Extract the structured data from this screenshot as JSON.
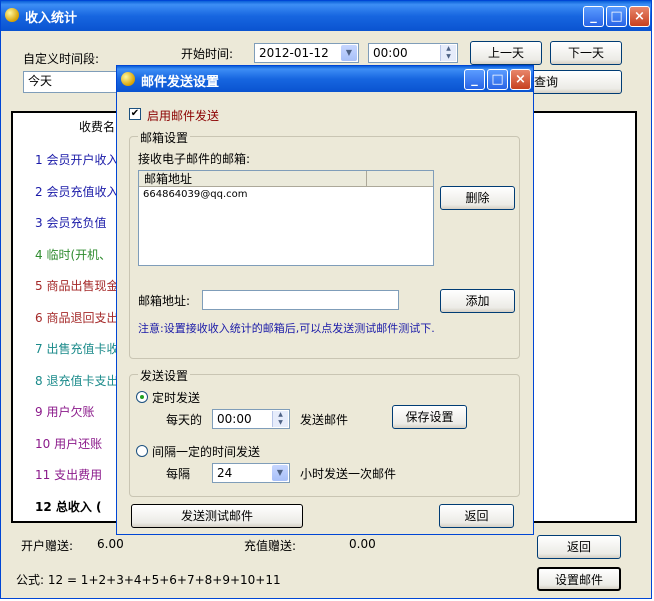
{
  "main": {
    "title": "收入统计",
    "custom_period_label": "自定义时间段:",
    "period_value": "今天",
    "start_time_label": "开始时间:",
    "start_date": "2012-01-12",
    "start_time": "00:00",
    "prev_day": "上一天",
    "next_day": "下一天",
    "query": "查询",
    "column_header": "收费名",
    "rows": [
      {
        "label": "1 会员开户收入",
        "color": "#1a1aa8"
      },
      {
        "label": "2 会员充值收入",
        "color": "#1a1aa8"
      },
      {
        "label": "3 会员充负值",
        "color": "#1a1aa8"
      },
      {
        "label": "4 临时(开机、",
        "color": "#2e8b2e"
      },
      {
        "label": "5 商品出售现金",
        "color": "#a52a2a"
      },
      {
        "label": "6 商品退回支出",
        "color": "#a52a2a"
      },
      {
        "label": "7 出售充值卡收",
        "color": "#1a8a8a"
      },
      {
        "label": "8 退充值卡支出",
        "color": "#1a8a8a"
      },
      {
        "label": "9 用户欠账",
        "color": "#8b1a8b"
      },
      {
        "label": "10 用户还账",
        "color": "#8b1a8b"
      },
      {
        "label": "11 支出费用",
        "color": "#8b1a8b"
      },
      {
        "label": "12 总收入 (",
        "color": "#000000"
      }
    ],
    "open_gift_label": "开户赠送:",
    "open_gift_value": "6.00",
    "recharge_gift_label": "充值赠送:",
    "recharge_gift_value": "0.00",
    "formula": "公式: 12 = 1+2+3+4+5+6+7+8+9+10+11",
    "back": "返回",
    "set_mail": "设置邮件"
  },
  "dialog": {
    "title": "邮件发送设置",
    "enable_label": "启用邮件发送",
    "enable_checked": true,
    "mailbox_group": "邮箱设置",
    "receive_label": "接收电子邮件的邮箱:",
    "list_header": "邮箱地址",
    "emails": [
      "664864039@qq.com"
    ],
    "delete": "删除",
    "address_label": "邮箱地址:",
    "address_value": "",
    "add": "添加",
    "note": "注意:设置接收收入统计的邮箱后,可以点发送测试邮件测试下.",
    "send_group": "发送设置",
    "timed_label": "定时发送",
    "daily_label": "每天的",
    "daily_time": "00:00",
    "send_mail_label": "发送邮件",
    "save_settings": "保存设置",
    "interval_label": "间隔一定的时间发送",
    "every_label": "每隔",
    "every_value": "24",
    "hours_label": "小时发送一次邮件",
    "test_mail": "发送测试邮件",
    "back": "返回"
  },
  "colors": {
    "titlebar": "#0a53d0",
    "link_text": "#1a1aa8",
    "note_text": "#1a1aa8"
  }
}
